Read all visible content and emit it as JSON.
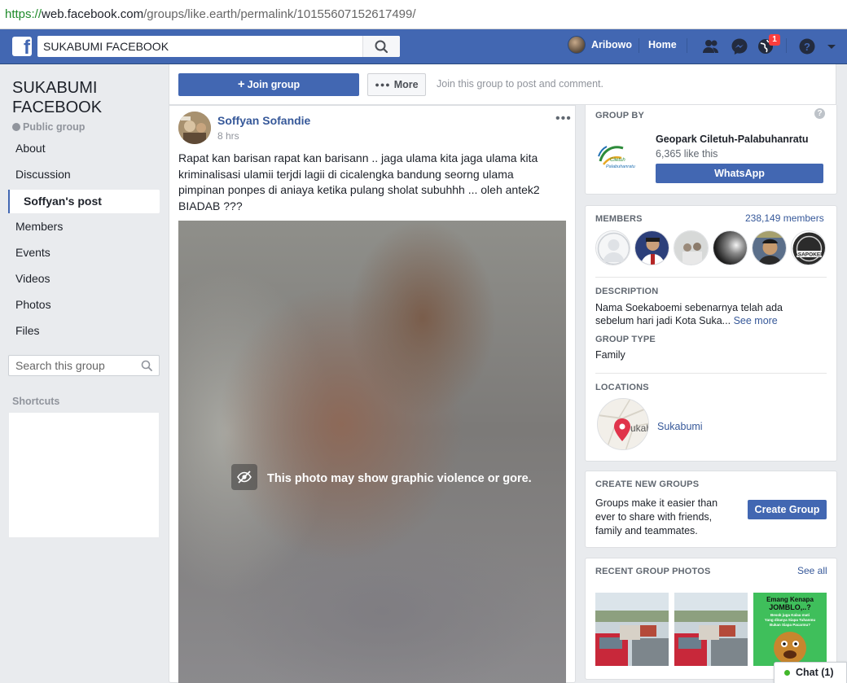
{
  "browser": {
    "url_scheme": "https://",
    "url_host": "web.facebook.com",
    "url_path": "/groups/like.earth/permalink/10155607152617499/"
  },
  "topbar": {
    "logo": "f",
    "search_value": "SUKABUMI FACEBOOK",
    "user_name": "Aribowo",
    "home_label": "Home",
    "notification_count": "1",
    "icons": [
      "friends-icon",
      "messenger-icon",
      "globe-notifications-icon",
      "help-icon",
      "chevron-down-icon"
    ]
  },
  "group": {
    "title": "SUKABUMI FACEBOOK",
    "privacy": "Public group",
    "nav": [
      "About",
      "Discussion",
      "Soffyan's post",
      "Members",
      "Events",
      "Videos",
      "Photos",
      "Files"
    ],
    "active_nav": "Soffyan's post",
    "search_placeholder": "Search this group",
    "shortcuts_label": "Shortcuts"
  },
  "actions": {
    "join_label": "Join group",
    "more_label": "More",
    "hint": "Join this group to post and comment."
  },
  "post": {
    "author": "Soffyan Sofandie",
    "time": "8 hrs",
    "menu": "•••",
    "text": "Rapat kan barisan rapat kan barisann .. jaga ulama kita jaga ulama kita kriminalisasi ulamii terjdi lagii di cicalengka bandung seorng ulama pimpinan ponpes di aniaya ketika pulang sholat subuhhh ... oleh antek2 BIADAB ???",
    "photo_warning": "This photo may show graphic violence or gore."
  },
  "sidebar": {
    "group_by_label": "GROUP BY",
    "page_name": "Geopark Ciletuh-Palabuhanratu",
    "page_likes": "6,365 like this",
    "page_logo_text": "Ciletuh Palabuhanratu",
    "whatsapp_label": "WhatsApp",
    "members_label": "MEMBERS",
    "members_count": "238,149 members",
    "description_label": "DESCRIPTION",
    "description_text": "Nama Soekaboemi sebenarnya telah ada sebelum hari jadi Kota Suka...",
    "see_more": "See more",
    "group_type_label": "GROUP TYPE",
    "group_type": "Family",
    "locations_label": "LOCATIONS",
    "location_name": "Sukabumi",
    "map_text": "ukab",
    "create_label": "CREATE NEW GROUPS",
    "create_text": "Groups make it easier than ever to share with friends, family and teammates.",
    "create_button": "Create Group",
    "photos_label": "RECENT GROUP PHOTOS",
    "see_all": "See all",
    "meme_lines": [
      "Emang Kenapa",
      "JOMBLO,..?",
      "Besok juga Kalau mati",
      "Yang ditanya Siapa Tuhanmu",
      "Bukan Siapa Pacarmu?"
    ]
  },
  "chat": {
    "label": "Chat (1)"
  },
  "colors": {
    "brand": "#4267b2",
    "link": "#365899",
    "background": "#e9ebee",
    "notification": "#fa3e3e",
    "online": "#42b72a"
  }
}
